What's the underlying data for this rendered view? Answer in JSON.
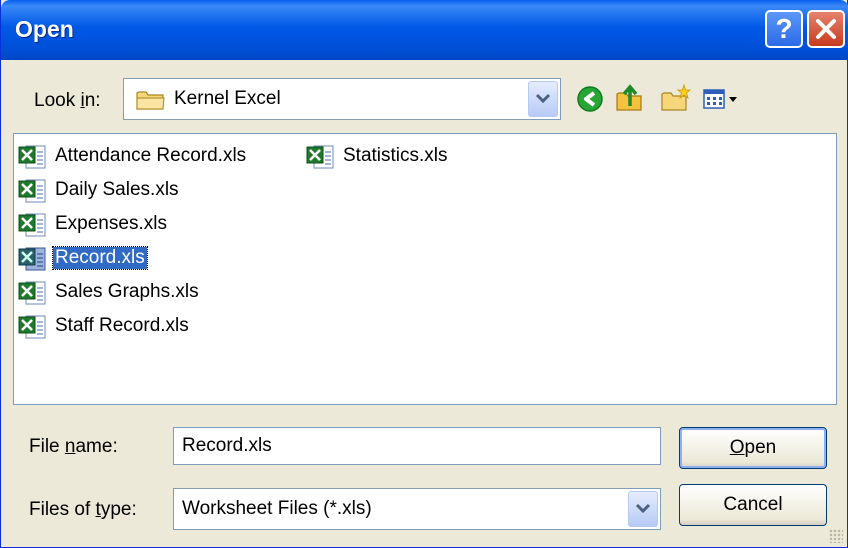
{
  "window": {
    "title": "Open"
  },
  "lookin": {
    "label_pre": "Look ",
    "label_ul": "i",
    "label_post": "n:",
    "value": "Kernel Excel"
  },
  "toolbar": {
    "back": "back-icon",
    "up": "up-folder-icon",
    "new_folder": "new-folder-icon",
    "views": "views-menu-icon"
  },
  "files": [
    {
      "name": "Attendance Record.xls",
      "selected": false
    },
    {
      "name": "Statistics.xls",
      "selected": false
    },
    {
      "name": "Daily Sales.xls",
      "selected": false
    },
    {
      "name": "Expenses.xls",
      "selected": false
    },
    {
      "name": "Record.xls",
      "selected": true
    },
    {
      "name": "Sales Graphs.xls",
      "selected": false
    },
    {
      "name": "Staff Record.xls",
      "selected": false
    }
  ],
  "filename": {
    "label_pre": "File ",
    "label_ul": "n",
    "label_post": "ame:",
    "value": "Record.xls"
  },
  "filetype": {
    "label_pre": "Files of ",
    "label_ul": "t",
    "label_post": "ype:",
    "value": "Worksheet Files (*.xls)"
  },
  "buttons": {
    "open_ul": "O",
    "open_rest": "pen",
    "cancel": "Cancel"
  },
  "colors": {
    "titlebar": "#0054e3",
    "selection": "#316ac5",
    "face": "#ece9d8"
  }
}
